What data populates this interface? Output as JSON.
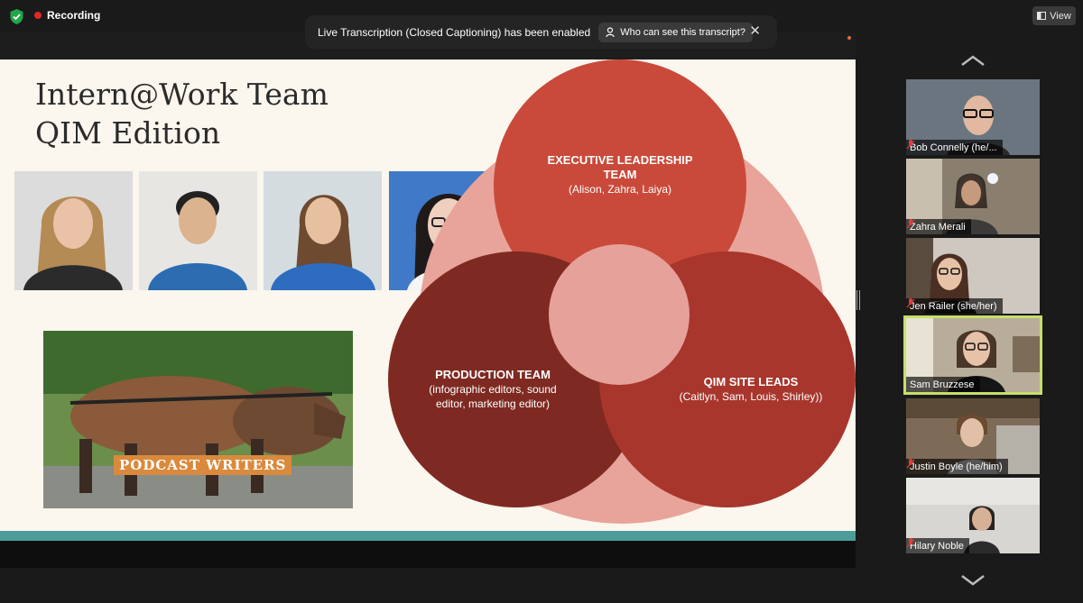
{
  "top_bar": {
    "recording_label": "Recording",
    "view_label": "View"
  },
  "notification": {
    "message": "Live Transcription (Closed Captioning) has been enabled",
    "who_button": "Who can see this transcript?",
    "close_icon": "close-icon"
  },
  "slide": {
    "title_line1": "Intern@Work Team",
    "title_line2": "QIM Edition",
    "horse_label": "PODCAST WRITERS",
    "venn": {
      "top": {
        "title": "EXECUTIVE LEADERSHIP TEAM",
        "sub": "(Alison, Zahra, Laiya)"
      },
      "left": {
        "title": "PRODUCTION TEAM",
        "sub": "(infographic editors, sound editor, marketing editor)"
      },
      "right": {
        "title": "QIM SITE LEADS",
        "sub": "(Caitlyn, Sam, Louis, Shirley))"
      }
    },
    "colors": {
      "top_circle": "#c94a3a",
      "left_circle": "#7e2a22",
      "right_circle": "#a8362d",
      "back_shape": "#e8a49a",
      "teal_bar": "#4e9c9a"
    }
  },
  "participants": [
    {
      "name": "Bob Connelly (he/...",
      "muted": true,
      "active": false
    },
    {
      "name": "Zahra Merali",
      "muted": true,
      "active": false
    },
    {
      "name": "Jen Railer (she/her)",
      "muted": true,
      "active": false
    },
    {
      "name": "Sam Bruzzese",
      "muted": false,
      "active": true
    },
    {
      "name": "Justin Boyle (he/him)",
      "muted": true,
      "active": false
    },
    {
      "name": "Hilary Noble",
      "muted": true,
      "active": false
    }
  ]
}
